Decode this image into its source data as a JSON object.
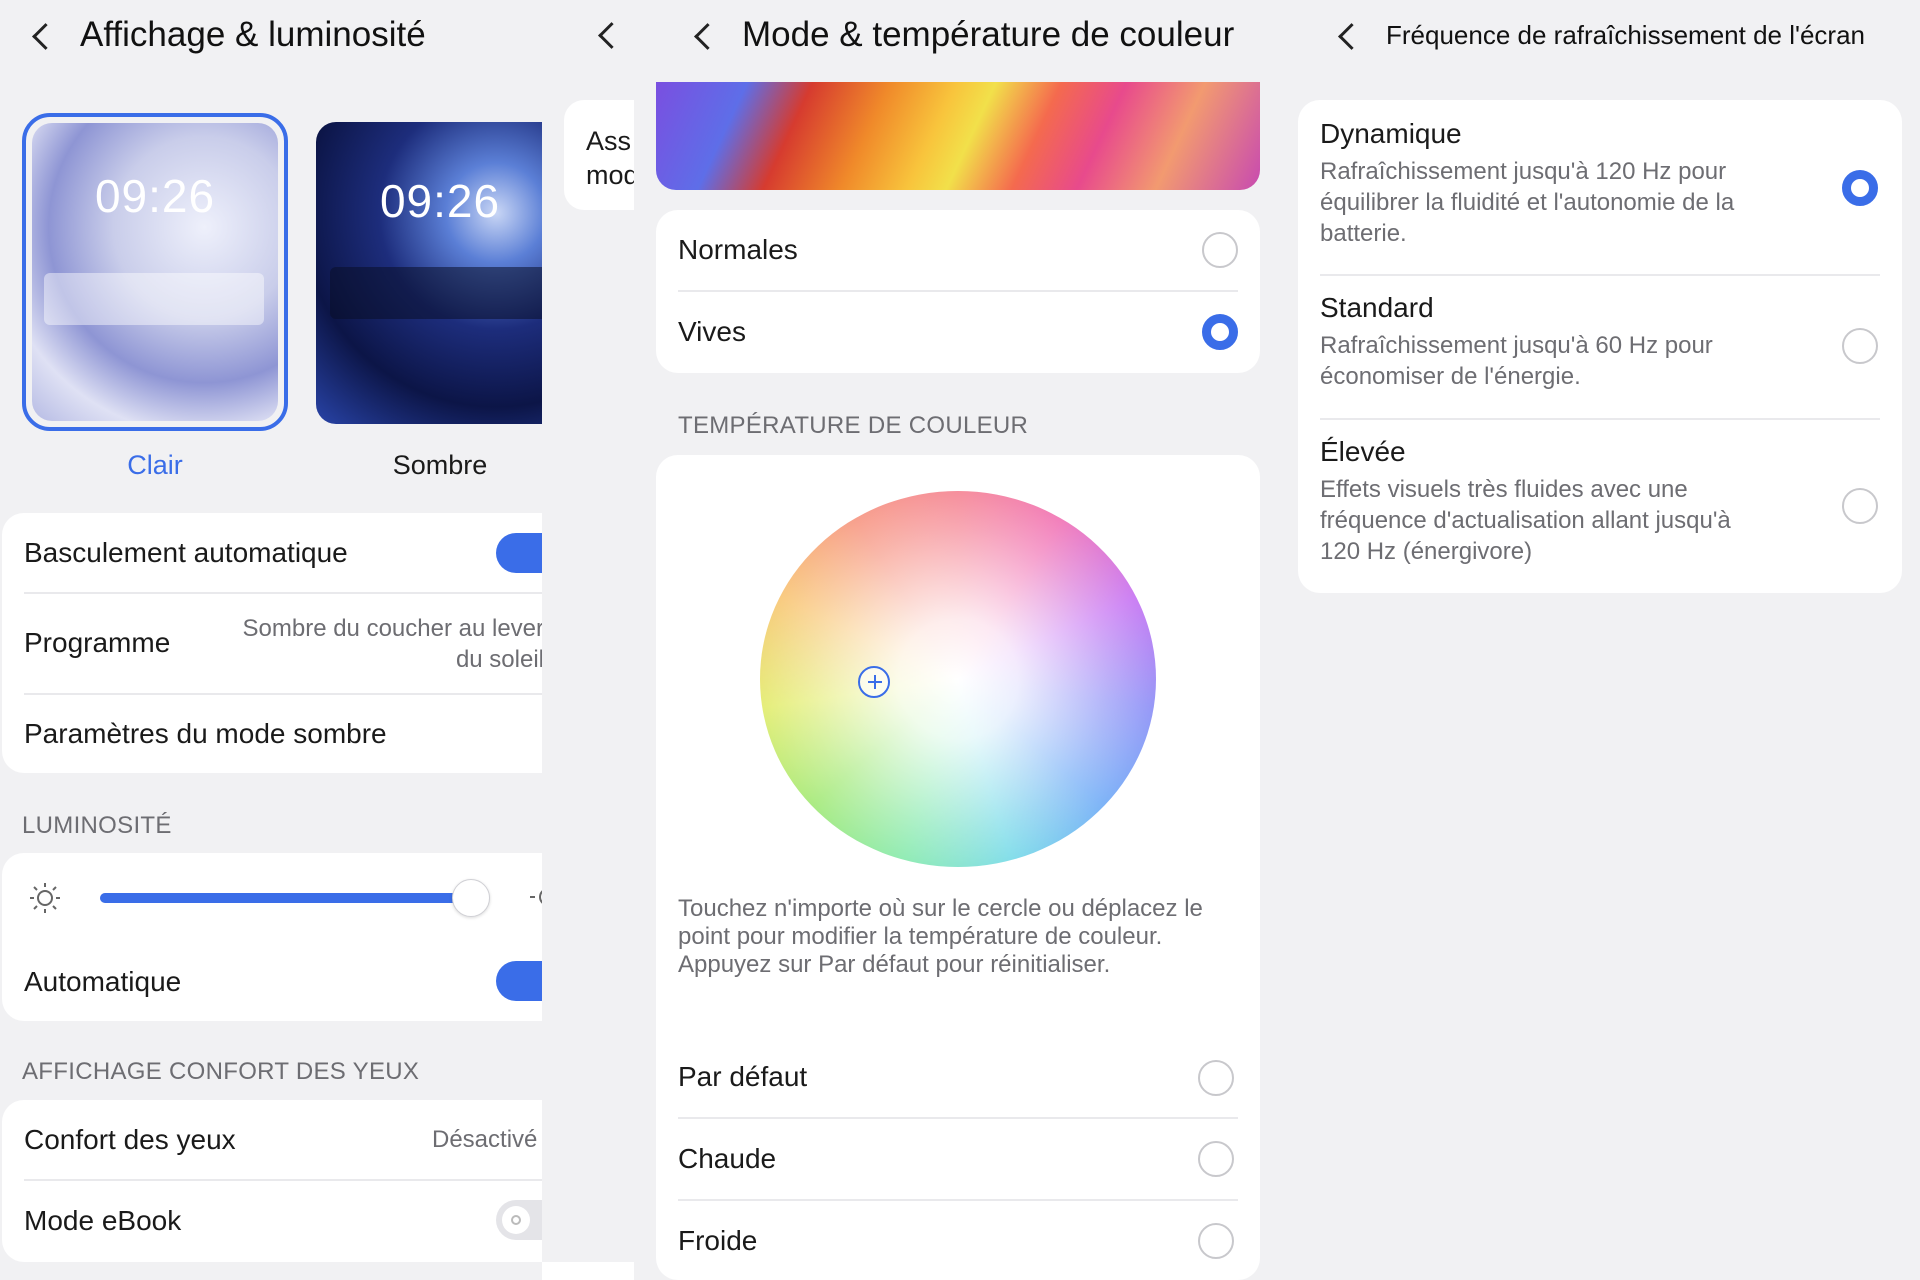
{
  "display": {
    "title": "Affichage & luminosité",
    "themes": [
      {
        "time": "09:26",
        "label": "Clair",
        "selected": true
      },
      {
        "time": "09:26",
        "label": "Sombre",
        "selected": false
      }
    ],
    "auto_switch_label": "Basculement automatique",
    "auto_switch_on": true,
    "schedule_label": "Programme",
    "schedule_value_line1": "Sombre du coucher au lever",
    "schedule_value_line2": "du soleil",
    "dark_settings_label": "Paramètres du mode sombre",
    "brightness_section": "LUMINOSITÉ",
    "brightness_level": 0.95,
    "auto_brightness_label": "Automatique",
    "auto_brightness_on": true,
    "eye_section": "AFFICHAGE CONFORT DES YEUX",
    "eye_comfort_label": "Confort des yeux",
    "eye_comfort_value": "Désactivé",
    "ebook_label": "Mode eBook",
    "ebook_on": false
  },
  "partial": {
    "text_line1": "Ass",
    "text_line2": "mod"
  },
  "color_mode": {
    "title": "Mode & température de couleur",
    "modes": [
      {
        "label": "Normales",
        "selected": false
      },
      {
        "label": "Vives",
        "selected": true
      }
    ],
    "temp_section": "TEMPÉRATURE DE COULEUR",
    "hint": "Touchez n'importe où sur le cercle ou déplacez le point pour modifier la température de couleur. Appuyez sur Par défaut pour réinitialiser.",
    "temps": [
      {
        "label": "Par défaut",
        "selected": false
      },
      {
        "label": "Chaude",
        "selected": false
      },
      {
        "label": "Froide",
        "selected": false
      }
    ]
  },
  "refresh": {
    "title": "Fréquence de rafraîchissement de l'écran",
    "options": [
      {
        "title": "Dynamique",
        "desc1": "Rafraîchissement jusqu'à 120 Hz pour",
        "desc2": "équilibrer la fluidité et l'autonomie de la",
        "desc3": "batterie.",
        "selected": true
      },
      {
        "title": "Standard",
        "desc1": "Rafraîchissement jusqu'à 60 Hz pour",
        "desc2": "économiser de l'énergie.",
        "desc3": "",
        "selected": false
      },
      {
        "title": "Élevée",
        "desc1": "Effets visuels très fluides avec une",
        "desc2": "fréquence d'actualisation allant jusqu'à",
        "desc3": "120 Hz (énergivore)",
        "selected": false
      }
    ]
  },
  "colors": {
    "accent": "#3a6de8",
    "background": "#f1f1f3"
  },
  "icons": {
    "back": "chevron-left-icon",
    "brightness_low": "sun-small-icon",
    "brightness_high": "sun-large-icon",
    "color_point": "crosshair-icon"
  }
}
